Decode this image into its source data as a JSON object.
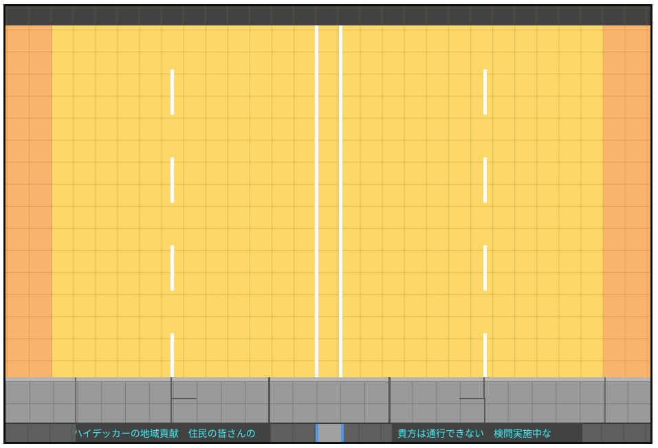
{
  "scene": {
    "colors": {
      "road": "#fdd866",
      "shoulder": "#f8b56b",
      "lane_marking": "#ffffff",
      "top_bar": "#424242",
      "sidewalk": "#9a9a9a",
      "sign_background": "#424242",
      "sign_text": "#3ff0f5",
      "gate_accent": "#4f97e0"
    },
    "signs": {
      "left_text": "ハイデッカーの地域貢献　住民の皆さんの",
      "right_text": "貴方は通行できない　検問実施中な"
    }
  }
}
